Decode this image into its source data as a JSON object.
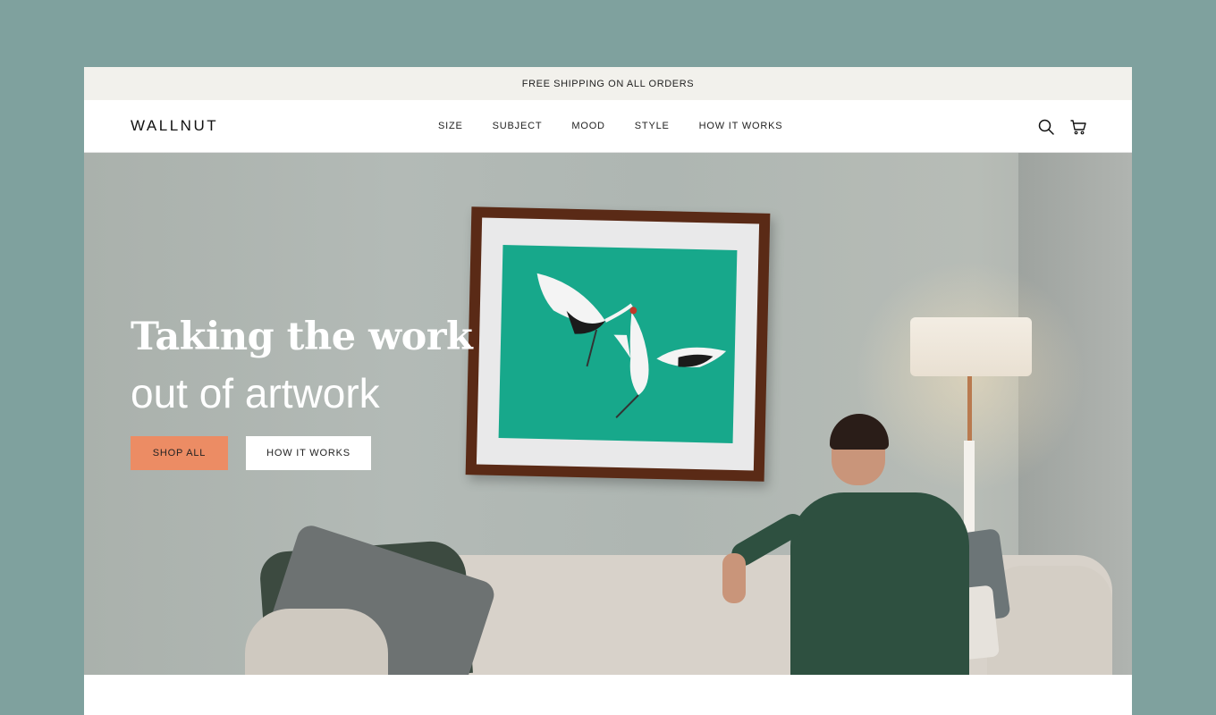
{
  "announcement": "FREE SHIPPING ON ALL ORDERS",
  "brand": "WALLNUT",
  "nav": {
    "links": [
      "SIZE",
      "SUBJECT",
      "MOOD",
      "STYLE",
      "HOW IT WORKS"
    ]
  },
  "icons": {
    "search": "search-icon",
    "cart": "cart-icon"
  },
  "hero": {
    "headline_line1": "Taking the work",
    "headline_line2": "out of artwork",
    "primary_cta": "SHOP ALL",
    "secondary_cta": "HOW IT WORKS"
  },
  "colors": {
    "page_background": "#7fa19e",
    "announcement_bar": "#f2f1ec",
    "primary_cta": "#ec8c64",
    "art_print": "#17a88b"
  }
}
